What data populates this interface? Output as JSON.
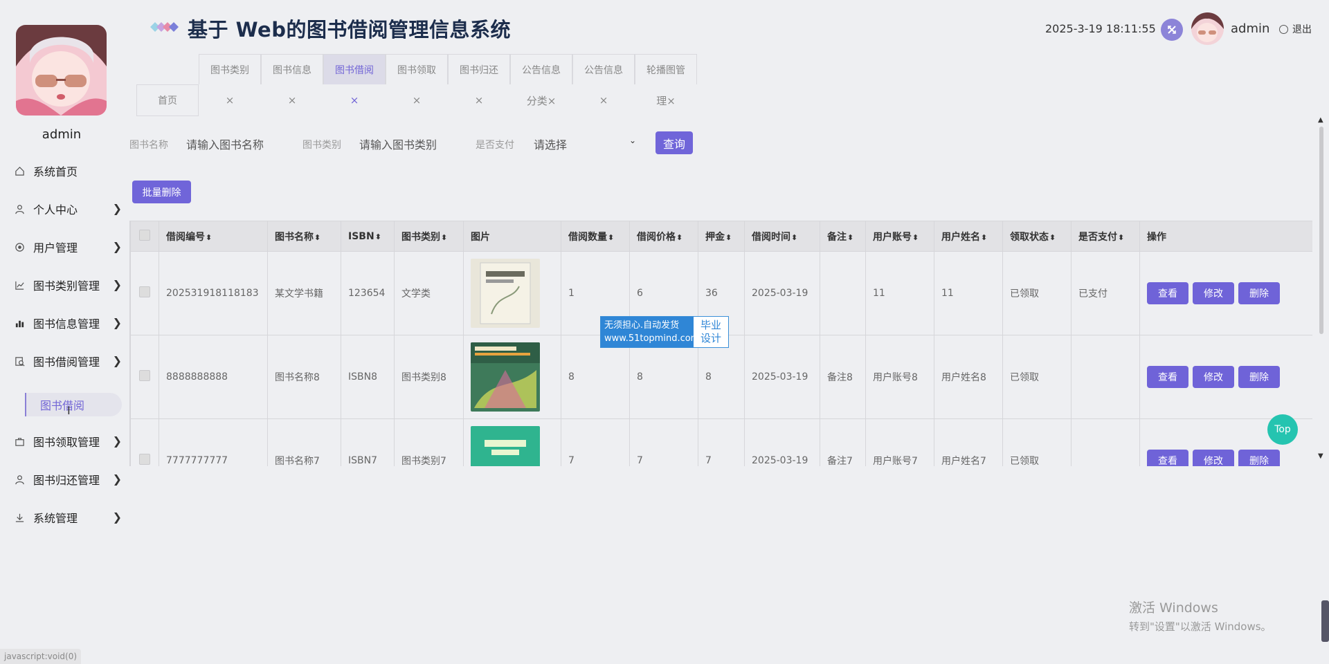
{
  "app": {
    "title": "基于 Web的图书借阅管理信息系统",
    "datetime": "2025-3-19 18:11:55",
    "username": "admin",
    "logout_label": "退出"
  },
  "sidebar": {
    "user": "admin",
    "items": [
      {
        "label": "系统首页",
        "icon": "home-icon",
        "has_arrow": false
      },
      {
        "label": "个人中心",
        "icon": "person-icon",
        "has_arrow": true
      },
      {
        "label": "用户管理",
        "icon": "target-icon",
        "has_arrow": true
      },
      {
        "label": "图书类别管理",
        "icon": "line-chart-icon",
        "has_arrow": true
      },
      {
        "label": "图书信息管理",
        "icon": "bar-chart-icon",
        "has_arrow": true
      },
      {
        "label": "图书借阅管理",
        "icon": "search-doc-icon",
        "has_arrow": true
      },
      {
        "label": "图书领取管理",
        "icon": "briefcase-icon",
        "has_arrow": true
      },
      {
        "label": "图书归还管理",
        "icon": "person-icon",
        "has_arrow": true
      },
      {
        "label": "系统管理",
        "icon": "download-icon",
        "has_arrow": true
      }
    ],
    "submenu_active": "图书借阅"
  },
  "tabs": {
    "top": [
      "图书类别",
      "图书信息",
      "图书借阅",
      "图书领取",
      "图书归还",
      "公告信息",
      "公告信息",
      "轮播图管"
    ],
    "active_index": 2,
    "home": "首页",
    "bottom": [
      "×",
      "×",
      "×",
      "×",
      "×",
      "分类×",
      "×",
      "理×"
    ]
  },
  "search": {
    "name_label": "图书名称",
    "name_placeholder": "请输入图书名称",
    "category_label": "图书类别",
    "category_placeholder": "请输入图书类别",
    "paid_label": "是否支付",
    "paid_value": "请选择",
    "query_button": "查询"
  },
  "batch_delete_button": "批量删除",
  "table": {
    "columns": [
      "借阅编号",
      "图书名称",
      "ISBN",
      "图书类别",
      "图片",
      "借阅数量",
      "借阅价格",
      "押金",
      "借阅时间",
      "备注",
      "用户账号",
      "用户姓名",
      "领取状态",
      "是否支付",
      "操作"
    ],
    "sortable": [
      true,
      true,
      true,
      true,
      false,
      true,
      true,
      true,
      true,
      true,
      true,
      true,
      true,
      true,
      false
    ],
    "rows": [
      {
        "id": "202531918118183",
        "name": "某文学书籍",
        "isbn": "123654",
        "category": "文学类",
        "qty": "1",
        "price": "6",
        "deposit": "36",
        "date": "2025-03-19",
        "note": "",
        "account": "11",
        "username": "11",
        "status": "已领取",
        "paid": "已支付"
      },
      {
        "id": "8888888888",
        "name": "图书名称8",
        "isbn": "ISBN8",
        "category": "图书类别8",
        "qty": "8",
        "price": "8",
        "deposit": "8",
        "date": "2025-03-19",
        "note": "备注8",
        "account": "用户账号8",
        "username": "用户姓名8",
        "status": "已领取",
        "paid": ""
      },
      {
        "id": "7777777777",
        "name": "图书名称7",
        "isbn": "ISBN7",
        "category": "图书类别7",
        "qty": "7",
        "price": "7",
        "deposit": "7",
        "date": "2025-03-19",
        "note": "备注7",
        "account": "用户账号7",
        "username": "用户姓名7",
        "status": "已领取",
        "paid": ""
      }
    ],
    "row_actions": [
      "查看",
      "修改",
      "删除"
    ]
  },
  "watermark": {
    "line1": "无须担心.自动发货",
    "line2": "www.51topmind.com",
    "right1": "毕业",
    "right2": "设计"
  },
  "top_button": "Top",
  "windows_watermark": {
    "line1": "激活 Windows",
    "line2": "转到\"设置\"以激活 Windows。"
  },
  "status_url": "javascript:void(0)",
  "colors": {
    "accent": "#7065d9",
    "top_button": "#25c4b0",
    "title": "#1c2d4c"
  }
}
